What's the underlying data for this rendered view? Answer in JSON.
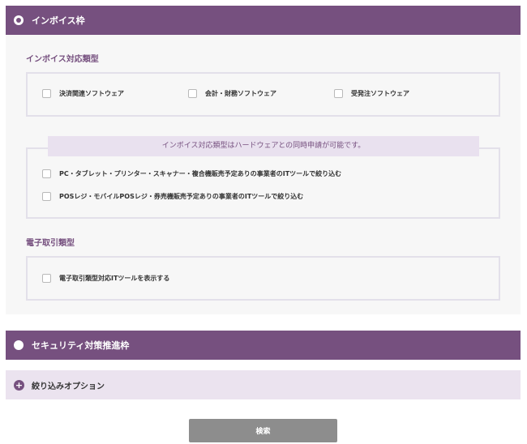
{
  "sections": {
    "invoice": {
      "title": "インボイス枠",
      "supported_types_label": "インボイス対応類型",
      "software_options": [
        "決済関連ソフトウェア",
        "会計・財務ソフトウェア",
        "受発注ソフトウェア"
      ],
      "hardware_notice": "インボイス対応類型はハードウェアとの同時申請が可能です。",
      "hardware_options": [
        "PC・タブレット・プリンター・スキャナー・複合機販売予定ありの事業者のITツールで絞り込む",
        "POSレジ・モバイルPOSレジ・券売機販売予定ありの事業者のITツールで絞り込む"
      ],
      "electronic_label": "電子取引類型",
      "electronic_option": "電子取引類型対応ITツールを表示する"
    },
    "security": {
      "title": "セキュリティ対策推進枠"
    },
    "filter_options": {
      "title": "絞り込みオプション"
    }
  },
  "search_button": "検索",
  "colors": {
    "accent": "#76507f",
    "panel_bg": "#f7f7f7",
    "notice_bg": "#e9e1ef",
    "button_bg": "#8d8d8d"
  }
}
